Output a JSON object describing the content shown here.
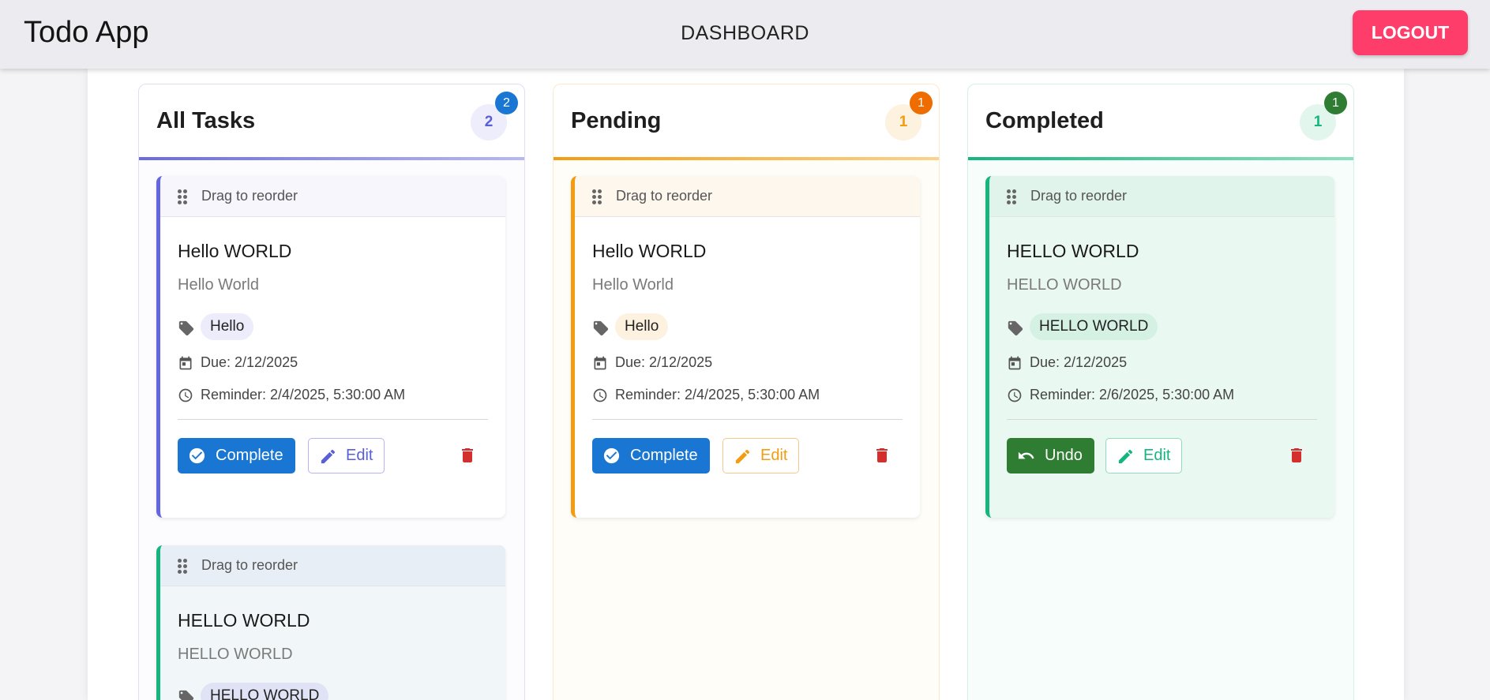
{
  "app": {
    "title": "Todo App",
    "nav": "DASHBOARD",
    "logout": "LOGOUT"
  },
  "colors": {
    "all": "#6366e0",
    "pending": "#f39c12",
    "completed": "#17b57e",
    "primary_button": "#1976d2",
    "undo_button": "#2e7d32",
    "delete": "#d32f2f",
    "logout": "#ff3d6b"
  },
  "columns": [
    {
      "title": "All Tasks",
      "count": "2",
      "cards": [
        {
          "drag": "Drag to reorder",
          "title": "Hello WORLD",
          "description": "Hello World",
          "tag": "Hello",
          "due": "Due: 2/12/2025",
          "reminder": "Reminder: 2/4/2025, 5:30:00 AM",
          "primary": "Complete",
          "edit": "Edit"
        },
        {
          "drag": "Drag to reorder",
          "title": "HELLO WORLD",
          "description": "HELLO WORLD",
          "tag": "HELLO WORLD"
        }
      ]
    },
    {
      "title": "Pending",
      "count": "1",
      "cards": [
        {
          "drag": "Drag to reorder",
          "title": "Hello WORLD",
          "description": "Hello World",
          "tag": "Hello",
          "due": "Due: 2/12/2025",
          "reminder": "Reminder: 2/4/2025, 5:30:00 AM",
          "primary": "Complete",
          "edit": "Edit"
        }
      ]
    },
    {
      "title": "Completed",
      "count": "1",
      "cards": [
        {
          "drag": "Drag to reorder",
          "title": "HELLO WORLD",
          "description": "HELLO WORLD",
          "tag": "HELLO WORLD",
          "due": "Due: 2/12/2025",
          "reminder": "Reminder: 2/6/2025, 5:30:00 AM",
          "primary": "Undo",
          "edit": "Edit"
        }
      ]
    }
  ]
}
